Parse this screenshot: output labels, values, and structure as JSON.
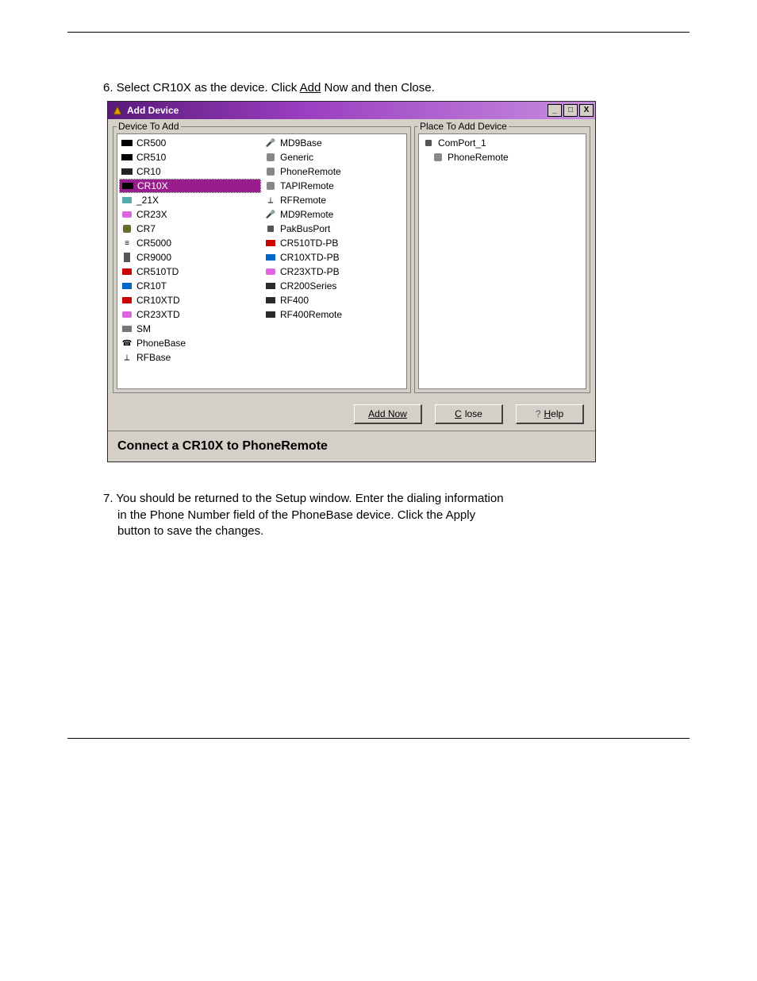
{
  "page": {
    "step_top_num": "6.",
    "step_top_text_pre": "Select CR10X as the device.  Click ",
    "step_top_link": "Add",
    "step_top_text_post": " Now and then Close.",
    "step_bottom_num": "7.",
    "step_bottom_line1": "You should be returned to the Setup window.  Enter the dialing information",
    "step_bottom_line2": "in the Phone Number field of the PhoneBase device.  Click the Apply",
    "step_bottom_line3": "button to save the changes."
  },
  "win": {
    "title": "Add Device",
    "gb_left": "Device To Add",
    "gb_right": "Place To Add Device",
    "statusbar": "Connect a CR10X to PhoneRemote",
    "btn_add": "Add Now",
    "btn_close_pre": "C",
    "btn_close_rest": "lose",
    "btn_help_pre": "H",
    "btn_help_rest": "elp"
  },
  "left_col1": [
    {
      "label": "CR500"
    },
    {
      "label": "CR510"
    },
    {
      "label": "CR10"
    },
    {
      "label": "CR10X",
      "sel": true
    },
    {
      "label": "_21X"
    },
    {
      "label": "CR23X"
    },
    {
      "label": "CR7"
    },
    {
      "label": "CR5000"
    },
    {
      "label": "CR9000"
    },
    {
      "label": "CR510TD"
    },
    {
      "label": "CR10T"
    },
    {
      "label": "CR10XTD"
    },
    {
      "label": "CR23XTD"
    },
    {
      "label": "SM"
    },
    {
      "label": "PhoneBase"
    },
    {
      "label": "RFBase"
    }
  ],
  "left_col2": [
    {
      "label": "MD9Base"
    },
    {
      "label": "Generic"
    },
    {
      "label": "PhoneRemote"
    },
    {
      "label": "TAPIRemote"
    },
    {
      "label": "RFRemote"
    },
    {
      "label": "MD9Remote"
    },
    {
      "label": "PakBusPort"
    },
    {
      "label": "CR510TD-PB"
    },
    {
      "label": "CR10XTD-PB"
    },
    {
      "label": "CR23XTD-PB"
    },
    {
      "label": "CR200Series"
    },
    {
      "label": "RF400"
    },
    {
      "label": "RF400Remote"
    }
  ],
  "right": [
    {
      "label": "ComPort_1"
    },
    {
      "label": "PhoneRemote",
      "indent": true
    }
  ]
}
